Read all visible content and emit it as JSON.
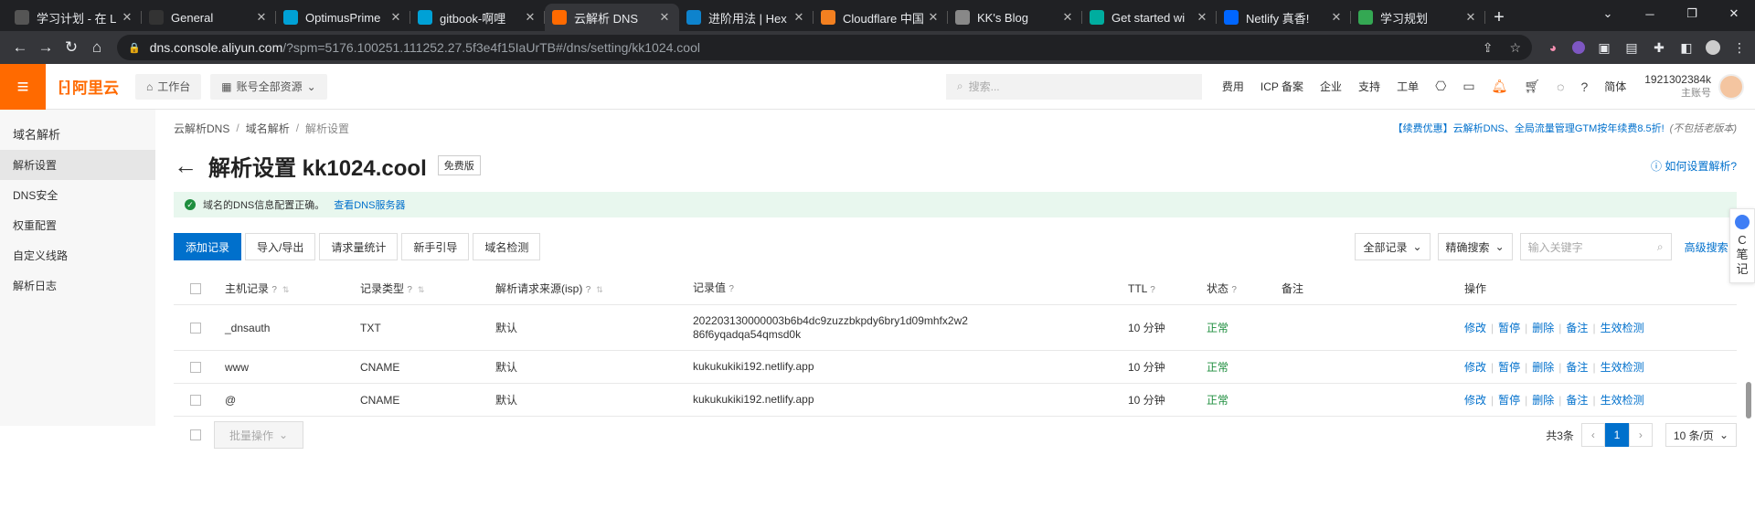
{
  "browser": {
    "tabs": [
      {
        "label": "学习计划 - 在 L",
        "icon": "notion-icon",
        "color": "#555"
      },
      {
        "label": "General",
        "icon": "github-icon",
        "color": "#333"
      },
      {
        "label": "OptimusPrime",
        "icon": "bilibili-icon",
        "color": "#00a1d6"
      },
      {
        "label": "gitbook-啊哩",
        "icon": "bilibili-icon",
        "color": "#00a1d6"
      },
      {
        "label": "云解析 DNS",
        "icon": "aliyun-icon",
        "color": "#ff6a00"
      },
      {
        "label": "进阶用法 | Hex",
        "icon": "hexo-icon",
        "color": "#0e83cd"
      },
      {
        "label": "Cloudflare 中国",
        "icon": "cloudflare-icon",
        "color": "#f38020"
      },
      {
        "label": "KK's Blog",
        "icon": "blog-icon",
        "color": "#888"
      },
      {
        "label": "Get started wi",
        "icon": "netlify-icon",
        "color": "#00ad9f"
      },
      {
        "label": "Netlify 真香!",
        "icon": "zhihu-icon",
        "color": "#0066ff"
      },
      {
        "label": "学习规划",
        "icon": "chrome-icon",
        "color": "#34a853"
      }
    ],
    "active_tab": 4,
    "url_host": "dns.console.aliyun.com",
    "url_path": "/?spm=5176.100251.111252.27.5f3e4f15IaUrTB#/dns/setting/kk1024.cool"
  },
  "topnav": {
    "logo": "阿里云",
    "workbench": "工作台",
    "resources": "账号全部资源",
    "search_placeholder": "搜索...",
    "links": [
      "费用",
      "ICP 备案",
      "企业",
      "支持",
      "工单"
    ],
    "lang": "简体",
    "account_id": "1921302384k",
    "account_role": "主账号"
  },
  "sidebar": {
    "title": "域名解析",
    "items": [
      "解析设置",
      "DNS安全",
      "权重配置",
      "自定义线路",
      "解析日志"
    ]
  },
  "breadcrumb": [
    "云解析DNS",
    "域名解析",
    "解析设置"
  ],
  "promo": {
    "text": "【续费优惠】云解析DNS、全局流量管理GTM按年续费8.5折!",
    "note": "(不包括老版本)"
  },
  "page": {
    "title": "解析设置 kk1024.cool",
    "edition": "免费版",
    "help": "如何设置解析?"
  },
  "alert": {
    "text": "域名的DNS信息配置正确。",
    "link": "查看DNS服务器"
  },
  "toolbar": {
    "add": "添加记录",
    "buttons": [
      "导入/导出",
      "请求量统计",
      "新手引导",
      "域名检测"
    ],
    "filter_all": "全部记录",
    "filter_mode": "精确搜索",
    "keyword_placeholder": "输入关键字",
    "advanced": "高级搜索"
  },
  "table": {
    "headers": [
      "主机记录",
      "记录类型",
      "解析请求来源(isp)",
      "记录值",
      "TTL",
      "状态",
      "备注",
      "操作"
    ],
    "rows": [
      {
        "host": "_dnsauth",
        "type": "TXT",
        "isp": "默认",
        "value1": "202203130000003b6b4dc9zuzzbkpdy6bry1d09mhfx2w2",
        "value2": "86f6yqadqa54qmsd0k",
        "ttl": "10 分钟",
        "status": "正常"
      },
      {
        "host": "www",
        "type": "CNAME",
        "isp": "默认",
        "value1": "kukukukiki192.netlify.app",
        "value2": "",
        "ttl": "10 分钟",
        "status": "正常"
      },
      {
        "host": "@",
        "type": "CNAME",
        "isp": "默认",
        "value1": "kukukukiki192.netlify.app",
        "value2": "",
        "ttl": "10 分钟",
        "status": "正常"
      }
    ],
    "actions": [
      "修改",
      "暂停",
      "删除",
      "备注",
      "生效检测"
    ]
  },
  "footer": {
    "batch": "批量操作",
    "total": "共3条",
    "page": "1",
    "page_size": "10 条/页"
  },
  "floatnote": {
    "c": "C",
    "l1": "笔",
    "l2": "记"
  },
  "colors": {
    "brand": "#ff6a00",
    "link": "#0070cc",
    "ok": "#1e8e3e"
  }
}
